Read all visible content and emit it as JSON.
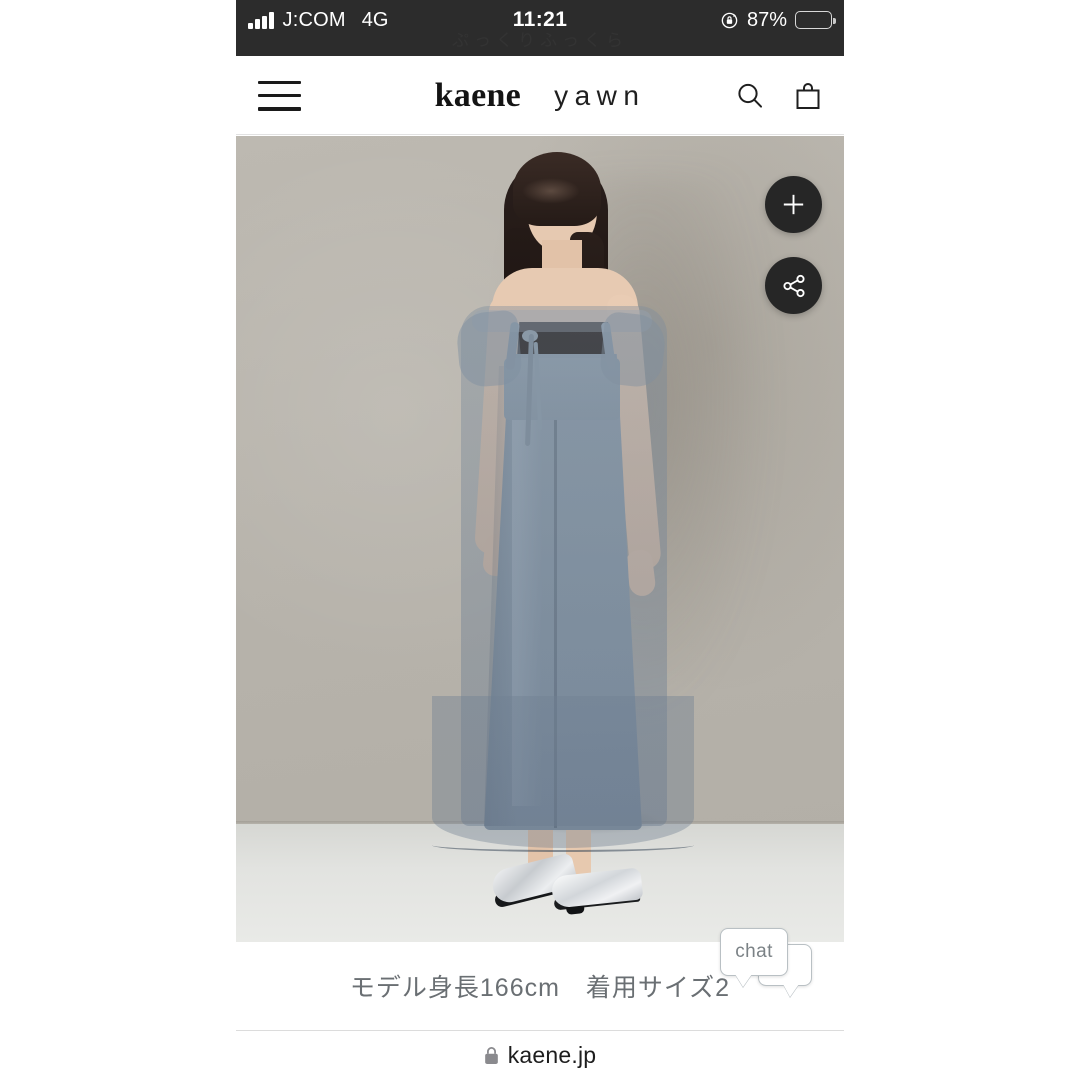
{
  "status_bar": {
    "carrier": "J:COM",
    "network": "4G",
    "signal_bars": 4,
    "time": "11:21",
    "battery_percent": "87%",
    "battery_level": 87,
    "battery_color": "#f6d330",
    "rotation_lock_icon": "rotation-lock-icon",
    "background_color": "#2c2c2c",
    "ghost_text": "ぷっくりふっくら"
  },
  "site_header": {
    "menu_icon": "hamburger-menu-icon",
    "brand_primary": "kaene",
    "brand_secondary": "yawn",
    "search_icon": "search-icon",
    "cart_icon": "shopping-bag-icon"
  },
  "product_image": {
    "alt_description": "model-back-view-sheer-overlay-camisole-dress",
    "dress_color": "#8b9aa8",
    "backdrop_color": "#b6b3ac",
    "floor_color": "#e4e5e2",
    "actions": [
      {
        "name": "zoom-expand-button",
        "icon": "plus-icon",
        "label": "+"
      },
      {
        "name": "share-button",
        "icon": "share-icon",
        "label": "share"
      }
    ],
    "action_button_color": "#262626"
  },
  "caption": {
    "text": "モデル身長166cm　着用サイズ2",
    "model_height": "166cm",
    "worn_size": "2",
    "text_color": "#6a6f73"
  },
  "chat_widget": {
    "label": "chat",
    "icon": "chat-bubbles-icon"
  },
  "browser_bar": {
    "lock_icon": "lock-icon",
    "url": "kaene.jp"
  }
}
